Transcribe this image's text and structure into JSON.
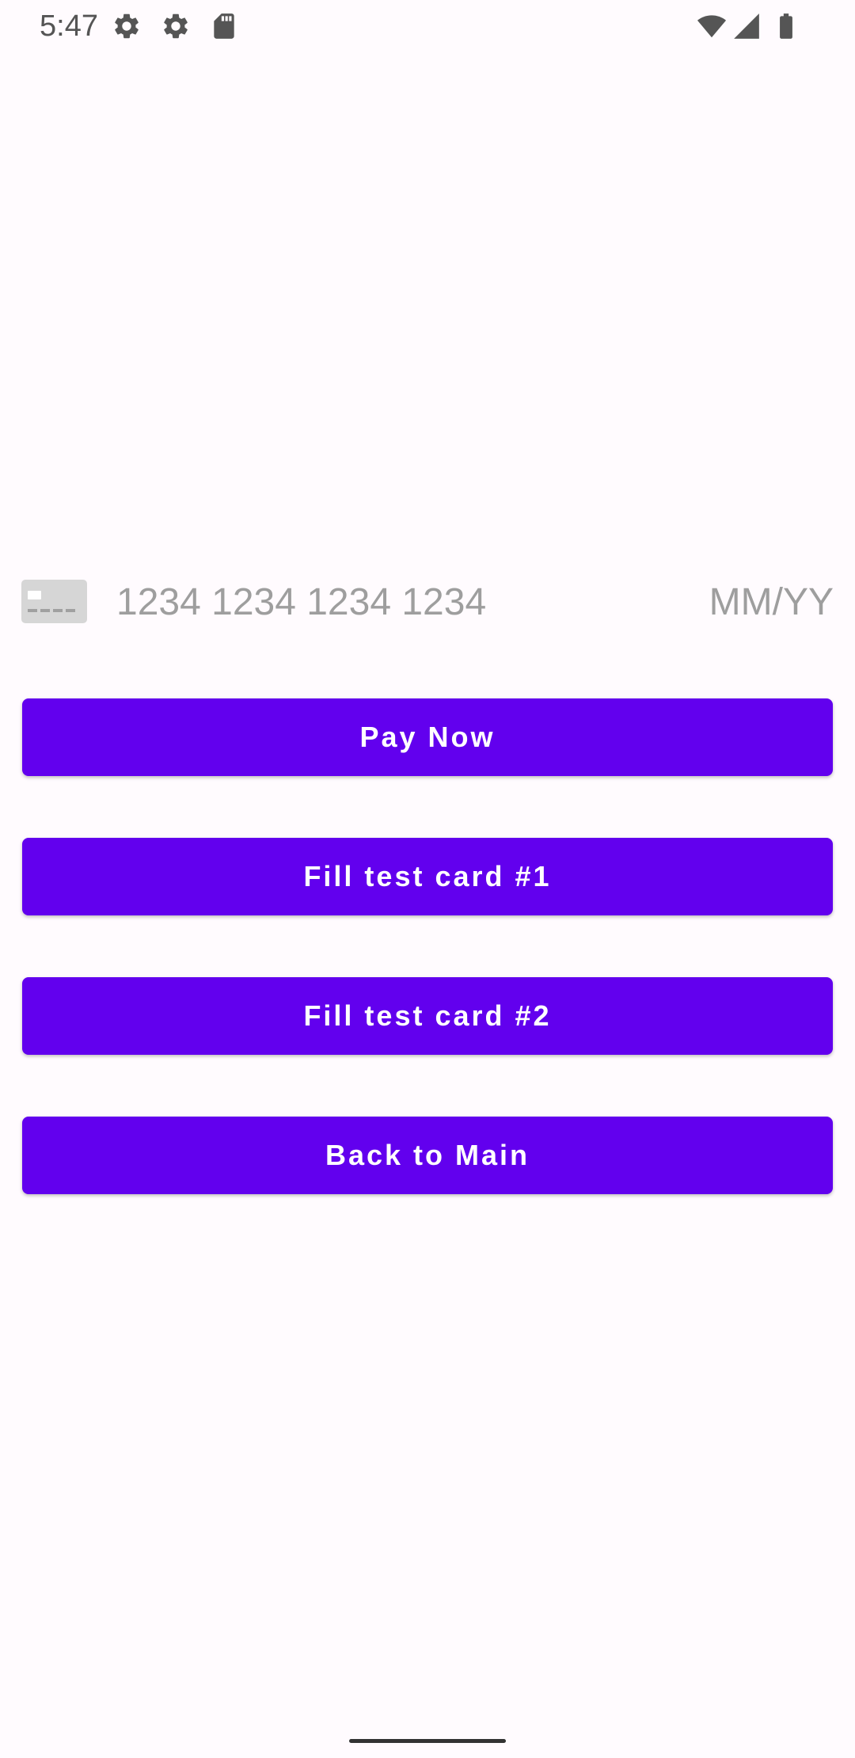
{
  "status_bar": {
    "time": "5:47",
    "left_icons": [
      "settings-gear-icon",
      "settings-gear-icon",
      "sd-card-icon"
    ],
    "right_icons": [
      "wifi-icon",
      "cell-signal-icon",
      "battery-icon"
    ],
    "icon_color": "#555555"
  },
  "card_form": {
    "brand_icon": "generic-card-icon",
    "card_number_placeholder": "1234 1234 1234 1234",
    "card_number_value": "",
    "expiry_placeholder": "MM/YY",
    "expiry_value": "",
    "placeholder_color": "#9e9e9e"
  },
  "buttons": {
    "pay_now": "Pay Now",
    "fill_test_card_1": "Fill test card #1",
    "fill_test_card_2": "Fill test card #2",
    "back_to_main": "Back to Main"
  },
  "colors": {
    "accent": "#6200ee",
    "button_text": "#ffffff",
    "background": "#fffbfe"
  }
}
